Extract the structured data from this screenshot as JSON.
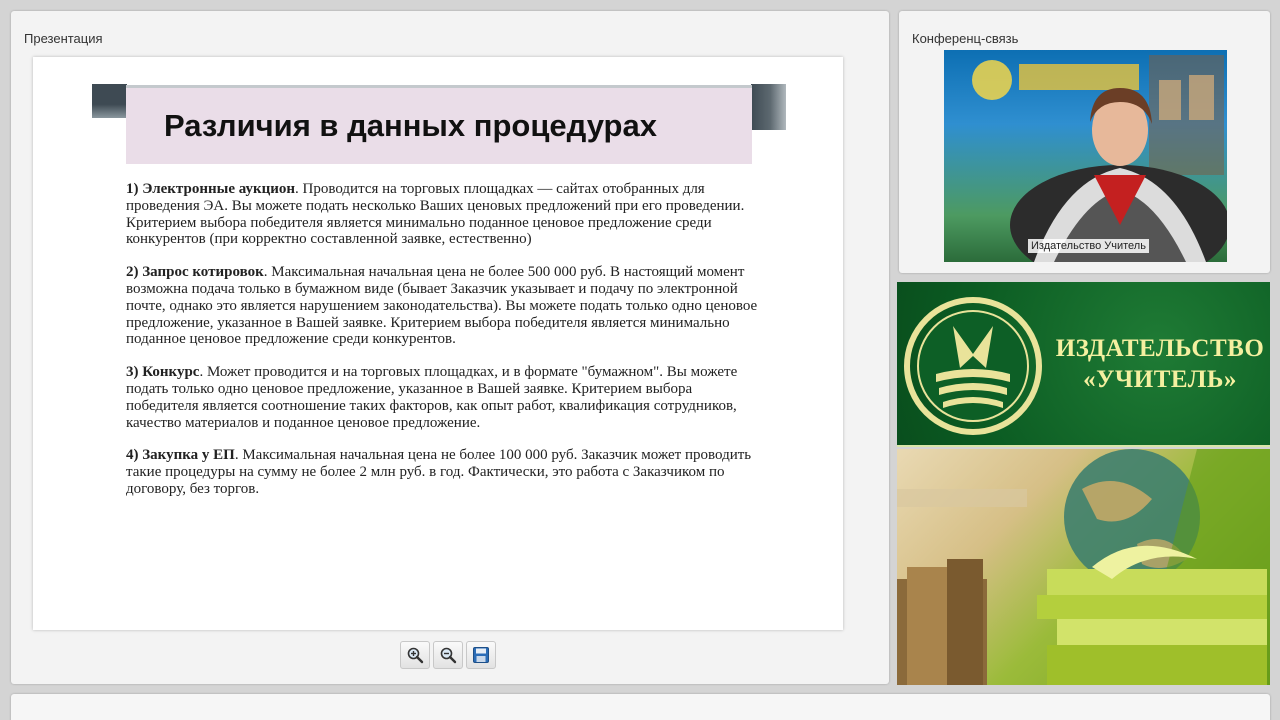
{
  "presentation": {
    "title": "Презентация",
    "slide": {
      "heading": "Различия в данных процедурах",
      "paragraphs": [
        {
          "bold": "1) Электронные аукцион",
          "text": ". Проводится на торговых площадках — сайтах отобранных для проведения ЭА. Вы можете подать несколько Ваших ценовых предложений при его проведении. Критерием выбора победителя является минимально поданное ценовое предложение среди конкурентов (при корректно составленной заявке, естественно)"
        },
        {
          "bold": "2) Запрос котировок",
          "text": ". Максимальная начальная цена не более 500 000 руб. В настоящий момент возможна подача только в бумажном виде (бывает Заказчик указывает и подачу по электронной почте, однако это является нарушением законодательства). Вы можете подать только одно ценовое предложение, указанное в Вашей заявке. Критерием выбора победителя является минимально поданное ценовое предложение среди конкурентов."
        },
        {
          "bold": "3) Конкурс",
          "text": ". Может проводится и на торговых площадках, и в формате \"бумажном\". Вы можете подать только одно ценовое предложение, указанное в Вашей заявке. Критерием выбора победителя является соотношение таких факторов, как опыт работ, квалификация сотрудников, качество материалов и поданное ценовое предложение."
        },
        {
          "bold": "4) Закупка у ЕП",
          "text": ". Максимальная начальная цена не более 100 000 руб. Заказчик может проводить такие процедуры на сумму не более 2 млн руб. в год. Фактически, это работа с Заказчиком по договору, без торгов."
        }
      ]
    },
    "toolbar": {
      "zoom_in_icon": "zoom-in-icon",
      "zoom_out_icon": "zoom-out-icon",
      "save_icon": "floppy-disk-icon"
    }
  },
  "conference": {
    "title": "Конференц-связь",
    "video_label": "Издательство Учитель"
  },
  "sidebar_banner": {
    "line1": "ИЗДАТЕЛЬСТВО",
    "line2": "«УЧИТЕЛЬ»"
  },
  "colors": {
    "slide_heading_bg": "#eadde8",
    "banner_green": "#0b5b22",
    "banner_text": "#f5f0a0"
  }
}
